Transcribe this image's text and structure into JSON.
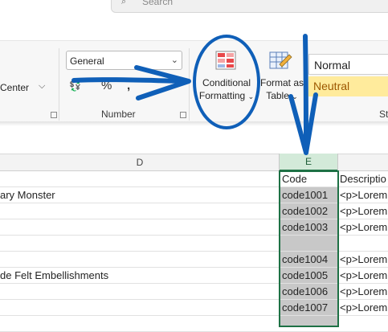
{
  "search": {
    "placeholder": "Search"
  },
  "ribbon": {
    "alignment": {
      "center_label": "Center"
    },
    "number": {
      "format_value": "General",
      "group_label": "Number",
      "format_icons": [
        "accounting-format-icon",
        "percent-style-icon",
        "comma-style-icon",
        "increase-decimal-icon",
        "decrease-decimal-icon"
      ]
    },
    "styles": {
      "conditional_formatting_line1": "Conditional",
      "conditional_formatting_line2": "Formatting",
      "format_as_table_line1": "Format as",
      "format_as_table_line2": "Table",
      "style_normal": "Normal",
      "style_neutral": "Neutral",
      "group_label": "St"
    }
  },
  "sheet": {
    "col_D": "D",
    "col_E": "E",
    "rows": [
      {
        "d": "",
        "e": "Code",
        "f": "Descriptio"
      },
      {
        "d": "ary Monster",
        "e": "code1001",
        "f": "<p>Lorem"
      },
      {
        "d": "",
        "e": "code1002",
        "f": "<p>Lorem"
      },
      {
        "d": "",
        "e": "code1003",
        "f": "<p>Lorem"
      },
      {
        "d": "",
        "e": "",
        "f": ""
      },
      {
        "d": "",
        "e": "code1004",
        "f": "<p>Lorem"
      },
      {
        "d": "de Felt Embellishments",
        "e": "code1005",
        "f": "<p>Lorem"
      },
      {
        "d": "",
        "e": "code1006",
        "f": "<p>Lorem"
      },
      {
        "d": "",
        "e": "code1007",
        "f": "<p>Lorem"
      },
      {
        "d": "",
        "e": "",
        "f": ""
      }
    ]
  },
  "colors": {
    "accent": "#1e7145",
    "annotation": "#0f5fb8",
    "neutral_fill": "#ffeb9c",
    "neutral_text": "#9c5700"
  }
}
